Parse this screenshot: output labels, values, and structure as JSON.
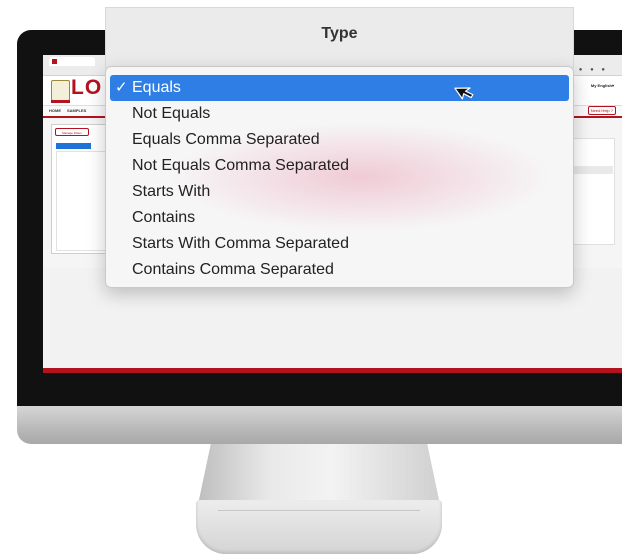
{
  "popup": {
    "title": "Type",
    "selected_index": 0,
    "check_glyph": "✓",
    "options": [
      "Equals",
      "Not Equals",
      "Equals Comma Separated",
      "Not Equals Comma Separated",
      "Starts With",
      "Contains",
      "Starts With Comma Separated",
      "Contains Comma Separated"
    ]
  },
  "background_app": {
    "logo_text": "LO",
    "language": "My English▾",
    "nav": {
      "home": "HOME",
      "samples": "SAMPLES"
    },
    "manage_filters_tab": "Manage Filters",
    "help": "Need Help ?"
  },
  "colors": {
    "selection_blue": "#2f7ee6",
    "brand_red": "#b3121f",
    "menu_bg": "#f6f6f6"
  },
  "icons": {
    "cursor": "arrow-pointer-icon",
    "check": "checkmark-icon"
  }
}
